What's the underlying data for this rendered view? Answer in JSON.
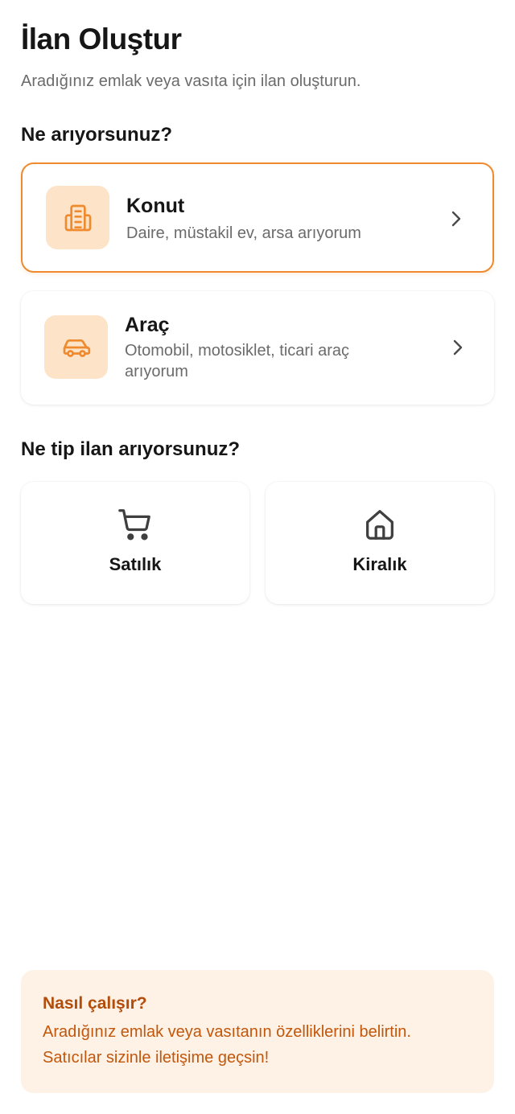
{
  "header": {
    "title": "İlan Oluştur",
    "subtitle": "Aradığınız emlak veya vasıta için ilan oluşturun."
  },
  "category_section": {
    "heading": "Ne arıyorsunuz?",
    "items": [
      {
        "title": "Konut",
        "description": "Daire, müstakil ev, arsa arıyorum",
        "icon": "building-icon",
        "selected": true
      },
      {
        "title": "Araç",
        "description": "Otomobil, motosiklet, ticari araç arıyorum",
        "icon": "car-icon",
        "selected": false
      }
    ]
  },
  "type_section": {
    "heading": "Ne tip ilan arıyorsunuz?",
    "items": [
      {
        "label": "Satılık",
        "icon": "shopping-cart-icon"
      },
      {
        "label": "Kiralık",
        "icon": "house-icon"
      }
    ]
  },
  "info": {
    "title": "Nasıl çalışır?",
    "line1": "Aradığınız emlak veya vasıtanın özelliklerini belirtin.",
    "line2": "Satıcılar sizinle iletişime geçsin!"
  },
  "colors": {
    "accent": "#ef8a2e",
    "accent_light": "#fde3c7",
    "info_bg": "#fef1e5",
    "info_text": "#c2570c"
  }
}
